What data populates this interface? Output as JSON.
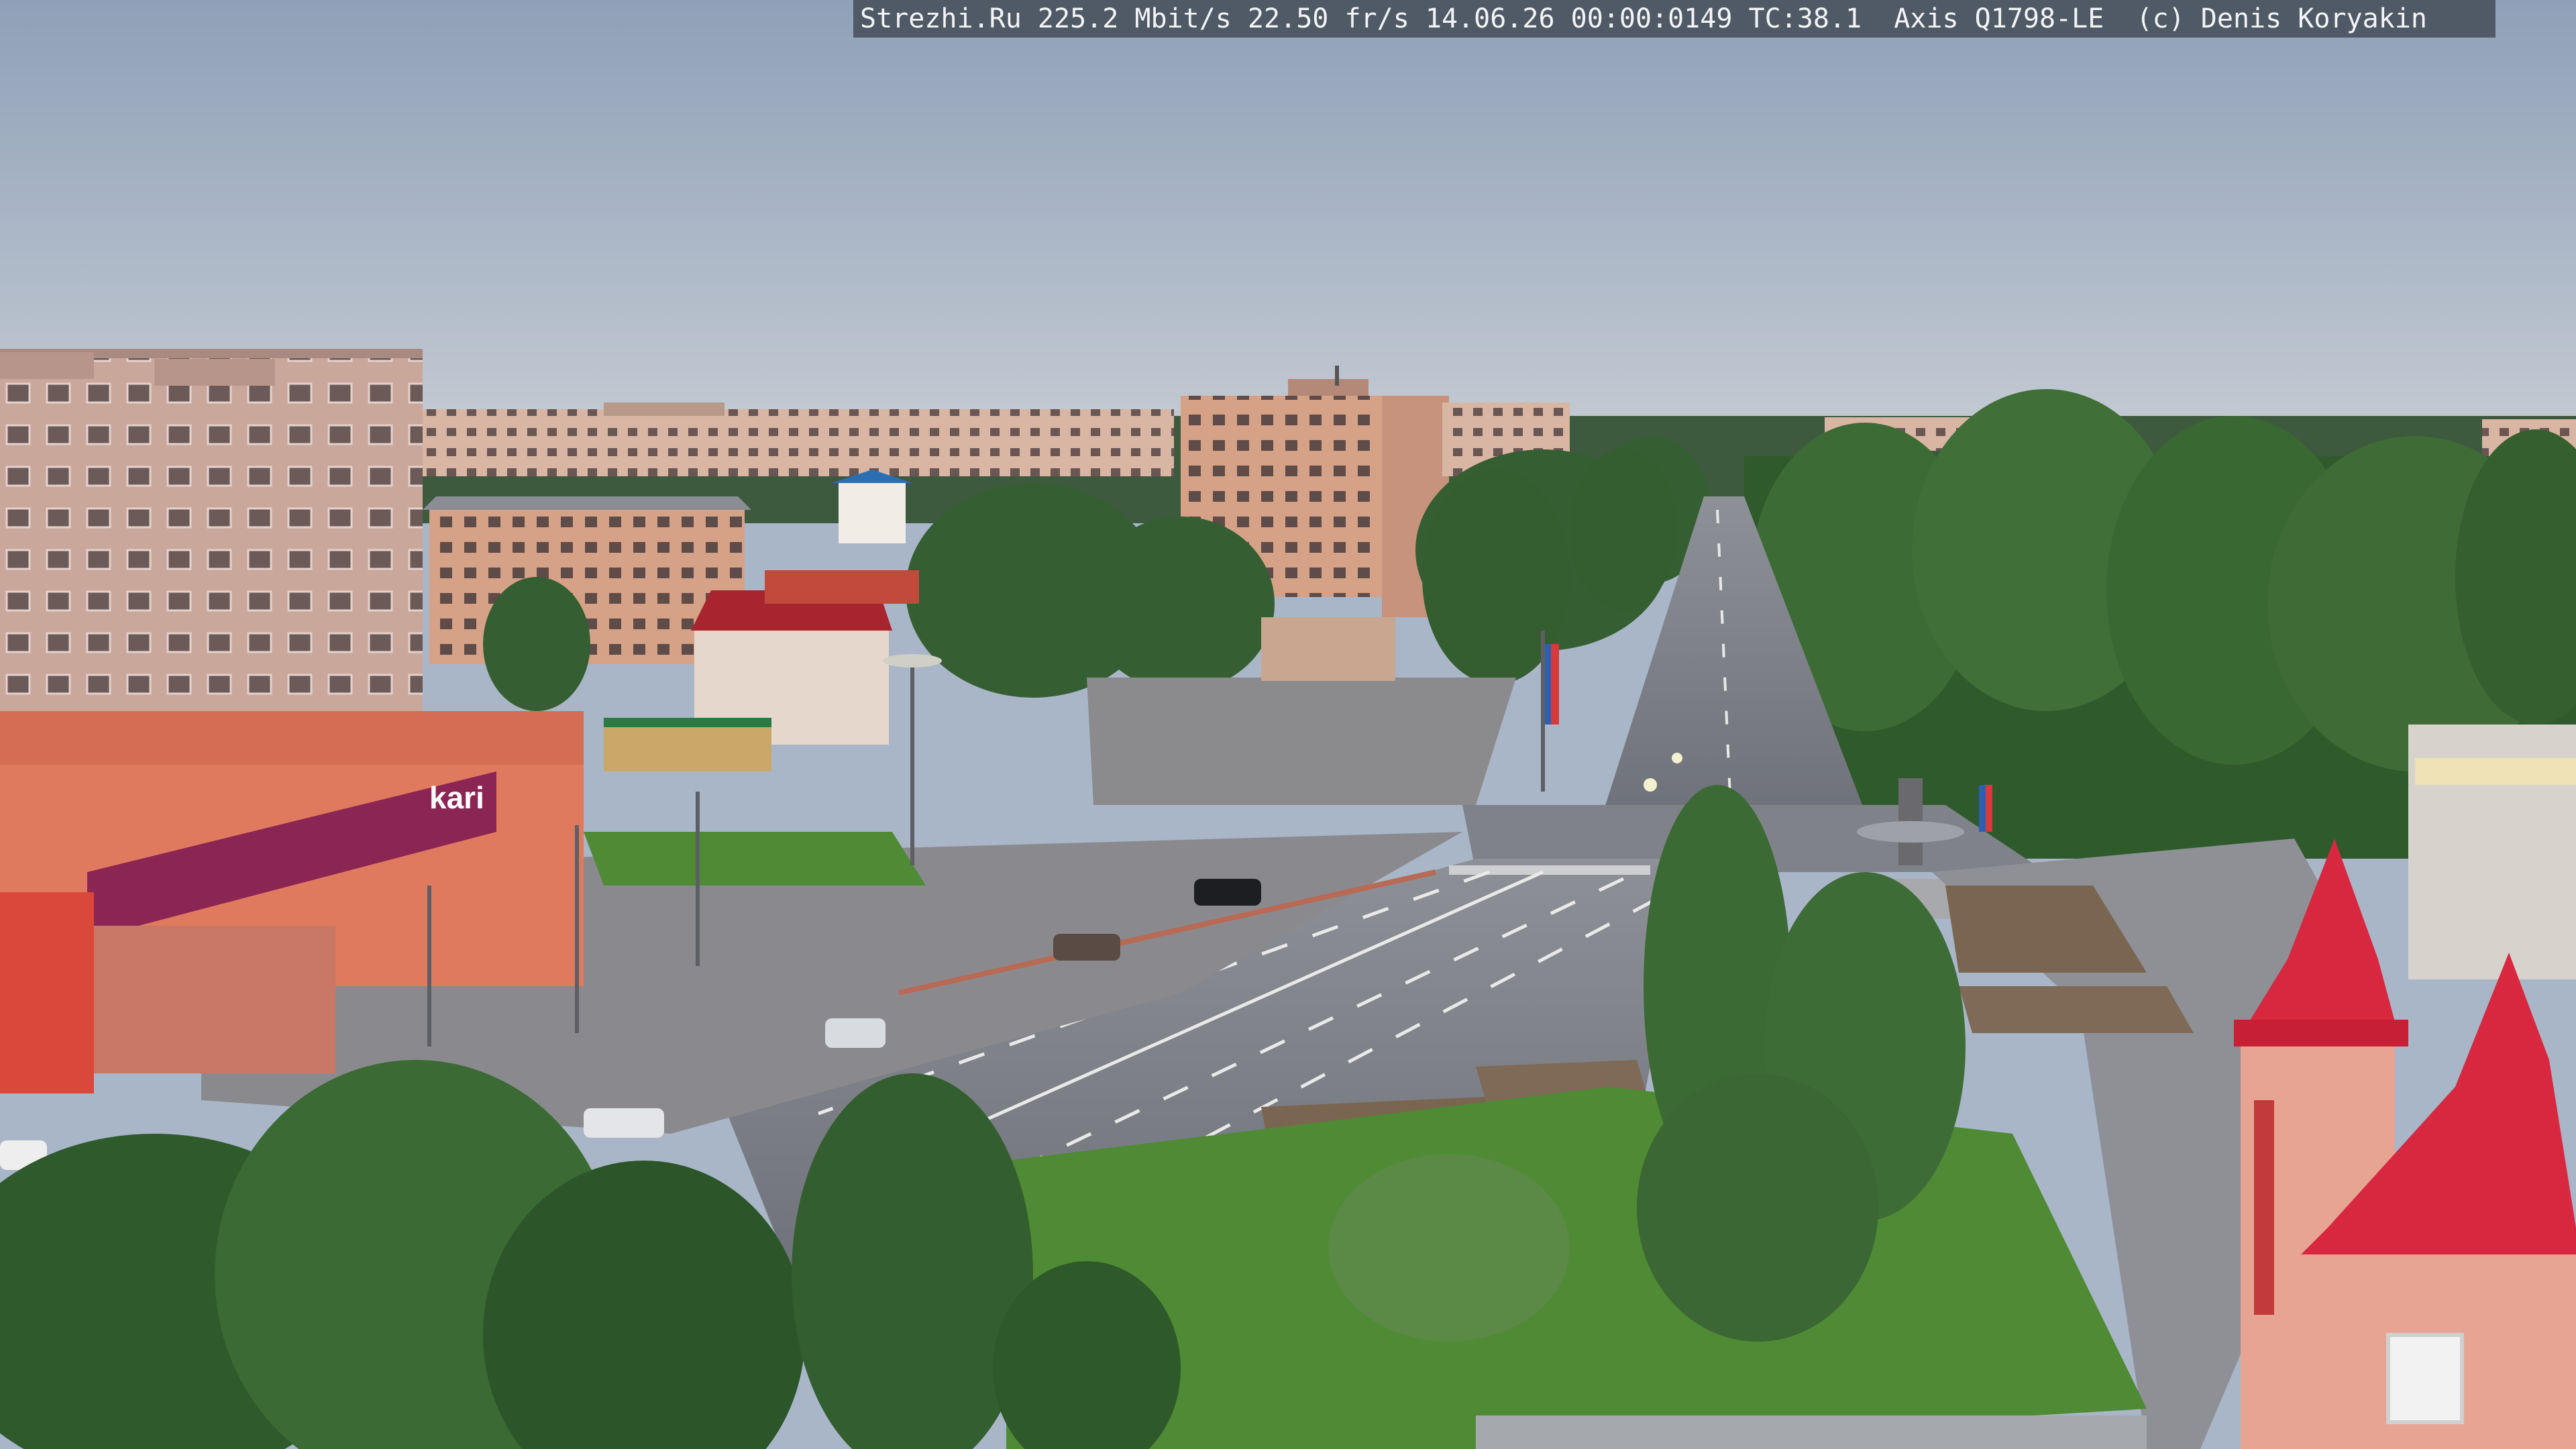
{
  "camera_overlay": {
    "text": "Strezhi.Ru 225.2 Mbit/s 22.50 fr/s 14.06.26 00:00:0149 TC:38.1  Axis Q1798-LE  (c) Denis Koryakin"
  },
  "scene": {
    "store_sign": "kari",
    "colors": {
      "sky_top": "#8fa0b8",
      "sky_bottom": "#c4cbd3",
      "panel_building": "#c9a79b",
      "store_facade": "#e07a5f",
      "store_banner": "#8b2553",
      "road": "#7d8088",
      "tree_dark": "#2f5a2c",
      "tree_light": "#5a8a45",
      "grass": "#4f8a34",
      "roof_red": "#d8283f"
    }
  }
}
